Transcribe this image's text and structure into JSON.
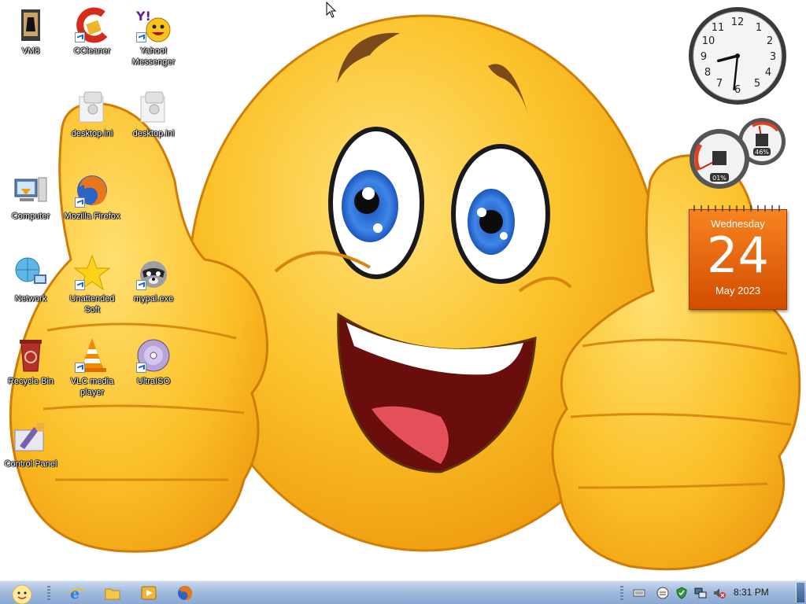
{
  "desktop": {
    "icons": [
      {
        "label": "VM8",
        "icon": "vm8-folder-icon"
      },
      {
        "label": "CCleaner",
        "icon": "ccleaner-icon"
      },
      {
        "label": "Yahoo! Messenger",
        "icon": "yahoo-messenger-icon"
      },
      {
        "label": "desktop.ini",
        "icon": "ini-file-icon"
      },
      {
        "label": "desktop.ini",
        "icon": "ini-file-icon"
      },
      {
        "label": "Computer",
        "icon": "computer-icon"
      },
      {
        "label": "Mozilla Firefox",
        "icon": "firefox-icon"
      },
      {
        "label": "Network",
        "icon": "network-icon"
      },
      {
        "label": "Unattended Soft",
        "icon": "star-icon"
      },
      {
        "label": "mypal.exe",
        "icon": "raccoon-icon"
      },
      {
        "label": "Recycle Bin",
        "icon": "recycle-bin-icon"
      },
      {
        "label": "VLC media player",
        "icon": "vlc-cone-icon"
      },
      {
        "label": "UltraISO",
        "icon": "disc-icon"
      },
      {
        "label": "Control Panel",
        "icon": "control-panel-icon"
      }
    ]
  },
  "gadgets": {
    "clock": {
      "hour": 8,
      "minute": 31
    },
    "meter": {
      "cpu_label": "01%",
      "memory_label": "46%",
      "cpu_value": 0.01,
      "memory_value": 0.46
    },
    "calendar": {
      "weekday": "Wednesday",
      "day": "24",
      "month_year": "May 2023"
    }
  },
  "taskbar": {
    "quick_launch": [
      "internet-explorer-icon",
      "folder-icon",
      "media-player-icon",
      "firefox-icon"
    ],
    "tray_icons": [
      "keyboard-icon",
      "messenger-icon",
      "shield-icon",
      "network-tray-icon",
      "volume-muted-icon"
    ],
    "time": "8:31 PM"
  },
  "colors": {
    "smiley": "#f9b91c",
    "calendar": "#e8670d",
    "taskbar": "#a8c0e0"
  }
}
